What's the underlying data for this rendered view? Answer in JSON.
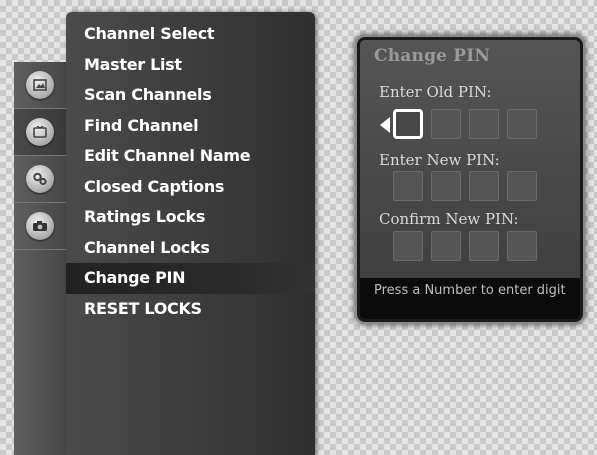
{
  "rail": {
    "icons": [
      {
        "name": "picture-icon"
      },
      {
        "name": "channel-icon"
      },
      {
        "name": "settings-gears-icon"
      },
      {
        "name": "camera-icon"
      }
    ],
    "active_index": 1
  },
  "menu": {
    "items": [
      "Channel Select",
      "Master List",
      "Scan Channels",
      "Find Channel",
      "Edit Channel Name",
      "Closed Captions",
      "Ratings Locks",
      "Channel Locks",
      "Change PIN",
      "RESET LOCKS"
    ],
    "selected": "Change PIN"
  },
  "dialog": {
    "title": "Change PIN",
    "old_pin_label": "Enter Old PIN:",
    "new_pin_label": "Enter New PIN:",
    "confirm_pin_label": "Confirm New PIN:",
    "digits_per_pin": 4,
    "footer_hint": "Press a Number to enter digit"
  },
  "colors": {
    "menu_bg": "#3a3a3a",
    "selected_row": "#222222",
    "dialog_bg": "#4a4a4a",
    "footer_bg": "#0b0b0b",
    "text": "#ffffff"
  }
}
